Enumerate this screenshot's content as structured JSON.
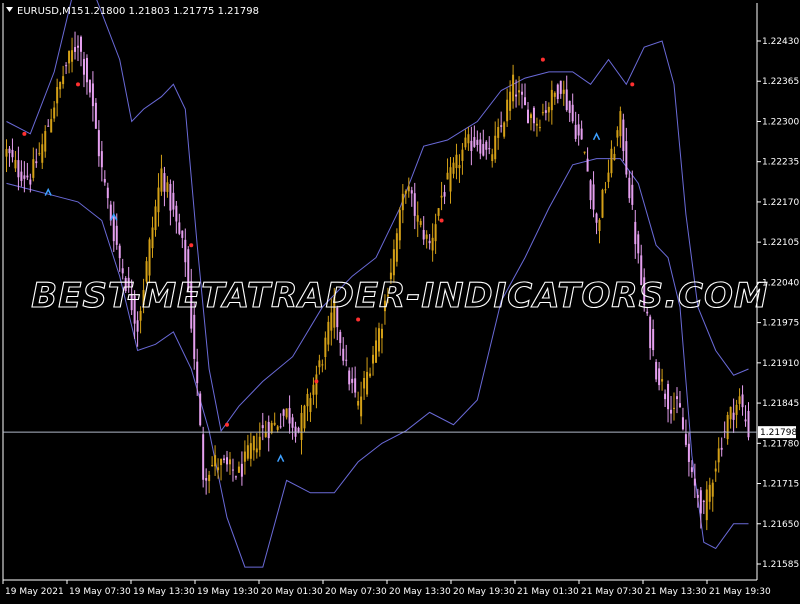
{
  "header": {
    "symbol": "EURUSD,M15",
    "quote": "1.21800 1.21803 1.21775 1.21798"
  },
  "watermark": "BEST-METATRADER-INDICATORS.COM",
  "colors": {
    "background": "#000000",
    "bull": "#d4a017",
    "bear": "#e6a0f0",
    "band": "#6a6ad8",
    "price_line": "#b0b8c8",
    "axis": "#ffffff",
    "marker_up": "#3da0ff",
    "marker_down": "#ff3030"
  },
  "chart_data": {
    "type": "candlestick",
    "symbol": "EURUSD",
    "timeframe": "M15",
    "current_price": 1.21798,
    "current_price_label": "1.21798",
    "ylim": [
      1.2155,
      1.2248
    ],
    "y_ticks": [
      "1.22430",
      "1.22365",
      "1.22300",
      "1.22235",
      "1.22170",
      "1.22105",
      "1.22040",
      "1.21975",
      "1.21910",
      "1.21845",
      "1.21780",
      "1.21715",
      "1.21650",
      "1.21585"
    ],
    "x_ticks": [
      "19 May 2021",
      "19 May 07:30",
      "19 May 13:30",
      "19 May 19:30",
      "20 May 01:30",
      "20 May 07:30",
      "20 May 13:30",
      "20 May 19:30",
      "21 May 01:30",
      "21 May 07:30",
      "21 May 13:30",
      "21 May 19:30"
    ],
    "close_path": [
      {
        "bar": 0,
        "close": 1.2225
      },
      {
        "bar": 4,
        "close": 1.2222
      },
      {
        "bar": 8,
        "close": 1.2221
      },
      {
        "bar": 12,
        "close": 1.2226
      },
      {
        "bar": 16,
        "close": 1.2233
      },
      {
        "bar": 20,
        "close": 1.2239
      },
      {
        "bar": 24,
        "close": 1.2243
      },
      {
        "bar": 28,
        "close": 1.2235
      },
      {
        "bar": 32,
        "close": 1.2222
      },
      {
        "bar": 36,
        "close": 1.2212
      },
      {
        "bar": 40,
        "close": 1.2204
      },
      {
        "bar": 44,
        "close": 1.2197
      },
      {
        "bar": 48,
        "close": 1.221
      },
      {
        "bar": 52,
        "close": 1.2222
      },
      {
        "bar": 56,
        "close": 1.2215
      },
      {
        "bar": 60,
        "close": 1.2208
      },
      {
        "bar": 64,
        "close": 1.2187
      },
      {
        "bar": 66,
        "close": 1.2173
      },
      {
        "bar": 70,
        "close": 1.2175
      },
      {
        "bar": 74,
        "close": 1.2174
      },
      {
        "bar": 78,
        "close": 1.2173
      },
      {
        "bar": 82,
        "close": 1.2177
      },
      {
        "bar": 86,
        "close": 1.218
      },
      {
        "bar": 90,
        "close": 1.2181
      },
      {
        "bar": 94,
        "close": 1.2183
      },
      {
        "bar": 98,
        "close": 1.218
      },
      {
        "bar": 102,
        "close": 1.2186
      },
      {
        "bar": 106,
        "close": 1.2192
      },
      {
        "bar": 110,
        "close": 1.22
      },
      {
        "bar": 114,
        "close": 1.219
      },
      {
        "bar": 118,
        "close": 1.2184
      },
      {
        "bar": 122,
        "close": 1.2191
      },
      {
        "bar": 126,
        "close": 1.2198
      },
      {
        "bar": 130,
        "close": 1.2209
      },
      {
        "bar": 134,
        "close": 1.222
      },
      {
        "bar": 138,
        "close": 1.2214
      },
      {
        "bar": 142,
        "close": 1.221
      },
      {
        "bar": 146,
        "close": 1.2218
      },
      {
        "bar": 150,
        "close": 1.2222
      },
      {
        "bar": 154,
        "close": 1.2226
      },
      {
        "bar": 158,
        "close": 1.2227
      },
      {
        "bar": 162,
        "close": 1.2224
      },
      {
        "bar": 166,
        "close": 1.2229
      },
      {
        "bar": 170,
        "close": 1.2236
      },
      {
        "bar": 174,
        "close": 1.2232
      },
      {
        "bar": 178,
        "close": 1.223
      },
      {
        "bar": 182,
        "close": 1.2233
      },
      {
        "bar": 186,
        "close": 1.2236
      },
      {
        "bar": 190,
        "close": 1.223
      },
      {
        "bar": 194,
        "close": 1.2225
      },
      {
        "bar": 198,
        "close": 1.2213
      },
      {
        "bar": 202,
        "close": 1.2222
      },
      {
        "bar": 206,
        "close": 1.223
      },
      {
        "bar": 210,
        "close": 1.2215
      },
      {
        "bar": 214,
        "close": 1.22
      },
      {
        "bar": 218,
        "close": 1.219
      },
      {
        "bar": 222,
        "close": 1.2185
      },
      {
        "bar": 226,
        "close": 1.2183
      },
      {
        "bar": 230,
        "close": 1.2172
      },
      {
        "bar": 234,
        "close": 1.2167
      },
      {
        "bar": 238,
        "close": 1.2175
      },
      {
        "bar": 242,
        "close": 1.2182
      },
      {
        "bar": 246,
        "close": 1.2185
      },
      {
        "bar": 249,
        "close": 1.218
      }
    ],
    "bollinger_upper": [
      {
        "bar": 0,
        "value": 1.223
      },
      {
        "bar": 8,
        "value": 1.2228
      },
      {
        "bar": 16,
        "value": 1.2238
      },
      {
        "bar": 22,
        "value": 1.225
      },
      {
        "bar": 30,
        "value": 1.225
      },
      {
        "bar": 38,
        "value": 1.224
      },
      {
        "bar": 42,
        "value": 1.223
      },
      {
        "bar": 46,
        "value": 1.2232
      },
      {
        "bar": 52,
        "value": 1.2234
      },
      {
        "bar": 56,
        "value": 1.2236
      },
      {
        "bar": 60,
        "value": 1.2232
      },
      {
        "bar": 64,
        "value": 1.221
      },
      {
        "bar": 68,
        "value": 1.219
      },
      {
        "bar": 72,
        "value": 1.218
      },
      {
        "bar": 78,
        "value": 1.2184
      },
      {
        "bar": 86,
        "value": 1.2188
      },
      {
        "bar": 96,
        "value": 1.2192
      },
      {
        "bar": 106,
        "value": 1.22
      },
      {
        "bar": 116,
        "value": 1.2205
      },
      {
        "bar": 124,
        "value": 1.2208
      },
      {
        "bar": 132,
        "value": 1.2216
      },
      {
        "bar": 140,
        "value": 1.2226
      },
      {
        "bar": 148,
        "value": 1.2227
      },
      {
        "bar": 158,
        "value": 1.223
      },
      {
        "bar": 166,
        "value": 1.2235
      },
      {
        "bar": 174,
        "value": 1.2237
      },
      {
        "bar": 182,
        "value": 1.2238
      },
      {
        "bar": 190,
        "value": 1.2238
      },
      {
        "bar": 196,
        "value": 1.2236
      },
      {
        "bar": 202,
        "value": 1.224
      },
      {
        "bar": 208,
        "value": 1.2236
      },
      {
        "bar": 214,
        "value": 1.2242
      },
      {
        "bar": 220,
        "value": 1.2243
      },
      {
        "bar": 224,
        "value": 1.2236
      },
      {
        "bar": 228,
        "value": 1.2215
      },
      {
        "bar": 232,
        "value": 1.22
      },
      {
        "bar": 238,
        "value": 1.2193
      },
      {
        "bar": 244,
        "value": 1.2189
      },
      {
        "bar": 249,
        "value": 1.219
      }
    ],
    "bollinger_lower": [
      {
        "bar": 0,
        "value": 1.222
      },
      {
        "bar": 8,
        "value": 1.2219
      },
      {
        "bar": 16,
        "value": 1.2218
      },
      {
        "bar": 24,
        "value": 1.2217
      },
      {
        "bar": 32,
        "value": 1.2214
      },
      {
        "bar": 38,
        "value": 1.2205
      },
      {
        "bar": 44,
        "value": 1.2193
      },
      {
        "bar": 50,
        "value": 1.2194
      },
      {
        "bar": 56,
        "value": 1.2196
      },
      {
        "bar": 62,
        "value": 1.219
      },
      {
        "bar": 68,
        "value": 1.218
      },
      {
        "bar": 74,
        "value": 1.2166
      },
      {
        "bar": 80,
        "value": 1.2158
      },
      {
        "bar": 86,
        "value": 1.2158
      },
      {
        "bar": 94,
        "value": 1.2172
      },
      {
        "bar": 102,
        "value": 1.217
      },
      {
        "bar": 110,
        "value": 1.217
      },
      {
        "bar": 118,
        "value": 1.2175
      },
      {
        "bar": 126,
        "value": 1.2178
      },
      {
        "bar": 134,
        "value": 1.218
      },
      {
        "bar": 142,
        "value": 1.2183
      },
      {
        "bar": 150,
        "value": 1.2181
      },
      {
        "bar": 158,
        "value": 1.2185
      },
      {
        "bar": 166,
        "value": 1.2201
      },
      {
        "bar": 174,
        "value": 1.2208
      },
      {
        "bar": 182,
        "value": 1.2216
      },
      {
        "bar": 190,
        "value": 1.2223
      },
      {
        "bar": 198,
        "value": 1.2224
      },
      {
        "bar": 206,
        "value": 1.2224
      },
      {
        "bar": 212,
        "value": 1.222
      },
      {
        "bar": 218,
        "value": 1.221
      },
      {
        "bar": 222,
        "value": 1.2208
      },
      {
        "bar": 226,
        "value": 1.22
      },
      {
        "bar": 230,
        "value": 1.2176
      },
      {
        "bar": 234,
        "value": 1.2162
      },
      {
        "bar": 238,
        "value": 1.2161
      },
      {
        "bar": 244,
        "value": 1.2165
      },
      {
        "bar": 249,
        "value": 1.2165
      }
    ],
    "signals": [
      {
        "bar": 6,
        "direction": "down",
        "price": 1.2228
      },
      {
        "bar": 14,
        "direction": "up",
        "price": 1.2219
      },
      {
        "bar": 24,
        "direction": "down",
        "price": 1.2236
      },
      {
        "bar": 36,
        "direction": "up",
        "price": 1.2215
      },
      {
        "bar": 62,
        "direction": "down",
        "price": 1.221
      },
      {
        "bar": 74,
        "direction": "down",
        "price": 1.2181
      },
      {
        "bar": 92,
        "direction": "up",
        "price": 1.2176
      },
      {
        "bar": 104,
        "direction": "down",
        "price": 1.2188
      },
      {
        "bar": 118,
        "direction": "down",
        "price": 1.2198
      },
      {
        "bar": 146,
        "direction": "down",
        "price": 1.2214
      },
      {
        "bar": 180,
        "direction": "down",
        "price": 1.224
      },
      {
        "bar": 198,
        "direction": "up",
        "price": 1.2228
      },
      {
        "bar": 210,
        "direction": "down",
        "price": 1.2236
      }
    ]
  }
}
